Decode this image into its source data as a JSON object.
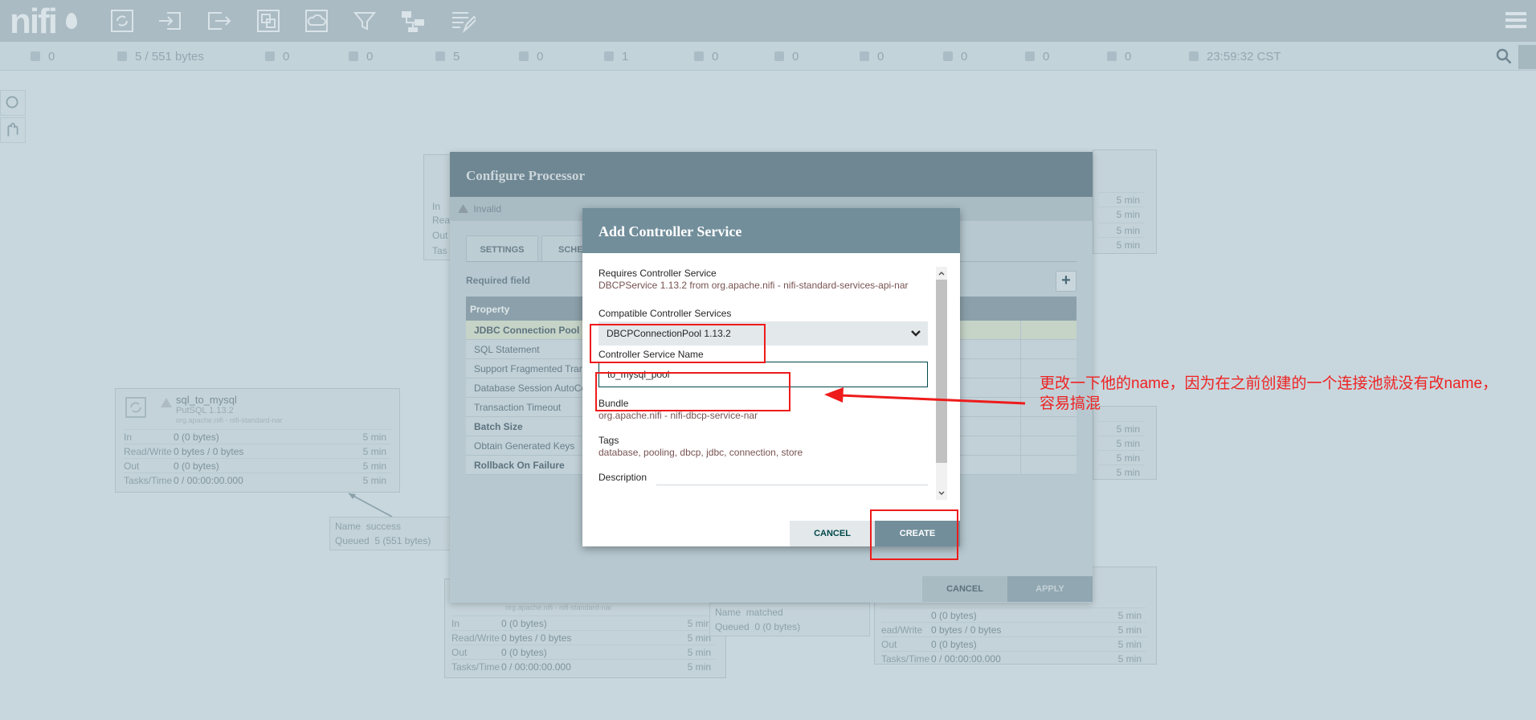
{
  "status_bar": {
    "active_threads": "0",
    "queued": "5 / 551 bytes",
    "transmitting": "0",
    "not_transmitting": "0",
    "running": "5",
    "stopped": "0",
    "invalid": "1",
    "disabled": "0",
    "up_to_date": "0",
    "locally_modified": "0",
    "stale": "0",
    "sync_failure": "0",
    "unknown": "0",
    "last_refresh": "23:59:32 CST"
  },
  "processor_sql_to_mysql": {
    "name": "sql_to_mysql",
    "type": "PutSQL 1.13.2",
    "bundle": "org.apache.nifi - nifi-standard-nar",
    "rows": [
      {
        "label": "In",
        "value": "0 (0 bytes)",
        "time": "5 min"
      },
      {
        "label": "Read/Write",
        "value": "0 bytes / 0 bytes",
        "time": "5 min"
      },
      {
        "label": "Out",
        "value": "0 (0 bytes)",
        "time": "5 min"
      },
      {
        "label": "Tasks/Time",
        "value": "0 / 00:00:00.000",
        "time": "5 min"
      }
    ]
  },
  "connection_success": {
    "name_label": "Name",
    "name": "success",
    "queued_label": "Queued",
    "queued": "5 (551 bytes)"
  },
  "processor_bottom_left": {
    "bundle": "org.apache.nifi - nifi-standard-nar",
    "rows": [
      {
        "label": "In",
        "value": "0 (0 bytes)",
        "time": "5 min"
      },
      {
        "label": "Read/Write",
        "value": "0 bytes / 0 bytes",
        "time": "5 min"
      },
      {
        "label": "Out",
        "value": "0 (0 bytes)",
        "time": "5 min"
      },
      {
        "label": "Tasks/Time",
        "value": "0 / 00:00:00.000",
        "time": "5 min"
      }
    ]
  },
  "connection_matched": {
    "name_label": "Name",
    "name": "matched",
    "queued_label": "Queued",
    "queued": "0 (0 bytes)"
  },
  "processor_bottom_right": {
    "rows": [
      {
        "label": "",
        "value": "0 (0 bytes)",
        "time": "5 min"
      },
      {
        "label": "ead/Write",
        "value": "0 bytes / 0 bytes",
        "time": "5 min"
      },
      {
        "label": "Out",
        "value": "0 (0 bytes)",
        "time": "5 min"
      },
      {
        "label": "Tasks/Time",
        "value": "0 / 00:00:00.000",
        "time": "5 min"
      }
    ]
  },
  "processor_top_left": {
    "row_labels": [
      "In",
      "Rea",
      "Out",
      "Tas"
    ]
  },
  "bg_time": "5 min",
  "configure_processor": {
    "title": "Configure Processor",
    "status": "Invalid",
    "tabs": [
      "SETTINGS",
      "SCHED"
    ],
    "required_field": "Required field",
    "property_header": "Property",
    "properties": [
      {
        "name": "JDBC Connection Pool",
        "bold": true
      },
      {
        "name": "SQL Statement",
        "bold": false
      },
      {
        "name": "Support Fragmented Tran",
        "bold": false
      },
      {
        "name": "Database Session AutoCo",
        "bold": false
      },
      {
        "name": "Transaction Timeout",
        "bold": false
      },
      {
        "name": "Batch Size",
        "bold": true
      },
      {
        "name": "Obtain Generated Keys",
        "bold": false
      },
      {
        "name": "Rollback On Failure",
        "bold": true
      }
    ],
    "cancel_label": "CANCEL",
    "apply_label": "APPLY"
  },
  "add_controller_service": {
    "title": "Add Controller Service",
    "requires_label": "Requires Controller Service",
    "requires_value": "DBCPService 1.13.2 from org.apache.nifi - nifi-standard-services-api-nar",
    "compatible_label": "Compatible Controller Services",
    "compatible_selected": "DBCPConnectionPool 1.13.2",
    "name_label": "Controller Service Name",
    "name_value": "to_mysql_pool",
    "bundle_label": "Bundle",
    "bundle_value": "org.apache.nifi - nifi-dbcp-service-nar",
    "tags_label": "Tags",
    "tags_value": "database, pooling, dbcp, jdbc, connection, store",
    "description_label": "Description",
    "cancel_label": "CANCEL",
    "create_label": "CREATE"
  },
  "annotation": {
    "text": "更改一下他的name，因为在之前创建的一个连接池就没有改name，容易搞混",
    "color": "#ee1b1b"
  },
  "colors": {
    "dialog_header": "#728e9b",
    "value_text": "#775351",
    "accent": "#004849"
  }
}
